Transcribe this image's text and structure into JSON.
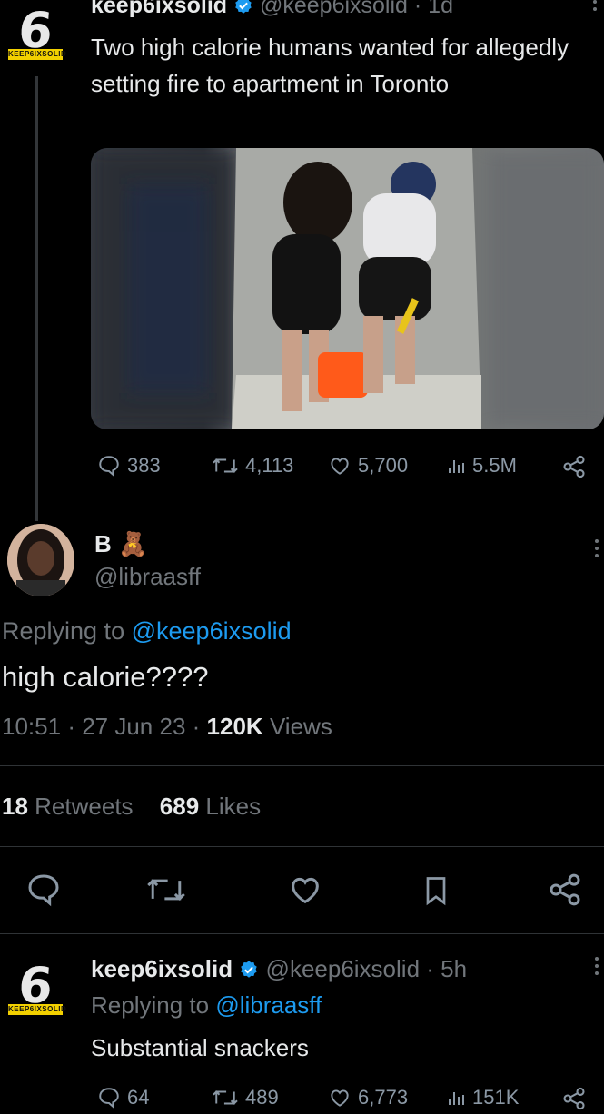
{
  "tweet": {
    "name": "keep6ixsolid",
    "handle": "@keep6ixsolid",
    "age": "· 1d",
    "logo_text": "KEEP6IXSOLID",
    "text": "Two high calorie humans wanted for allegedly setting fire to apartment in Toronto",
    "stats": {
      "replies": "383",
      "retweets": "4,113",
      "likes": "5,700",
      "views": "5.5M"
    }
  },
  "reply": {
    "name": "B",
    "emoji": "🧸",
    "handle": "@libraasff",
    "replying_prefix": "Replying to",
    "replying_to": "@keep6ixsolid",
    "text": "high calorie????",
    "time": "10:51",
    "date": "27 Jun 23",
    "views_count": "120K",
    "views_label": "Views",
    "retweets_count": "18",
    "retweets_label": "Retweets",
    "likes_count": "689",
    "likes_label": "Likes"
  },
  "response": {
    "name": "keep6ixsolid",
    "handle": "@keep6ixsolid",
    "age": "· 5h",
    "logo_text": "KEEP6IXSOLID",
    "replying_prefix": "Replying to",
    "replying_to": "@libraasff",
    "text": "Substantial snackers",
    "stats": {
      "replies": "64",
      "retweets": "489",
      "likes": "6,773",
      "views": "151K"
    }
  },
  "colors": {
    "background": "#000000",
    "text": "#e7e9ea",
    "muted": "#71767b",
    "link": "#1d9bf0",
    "verified": "#1d9bf0"
  }
}
